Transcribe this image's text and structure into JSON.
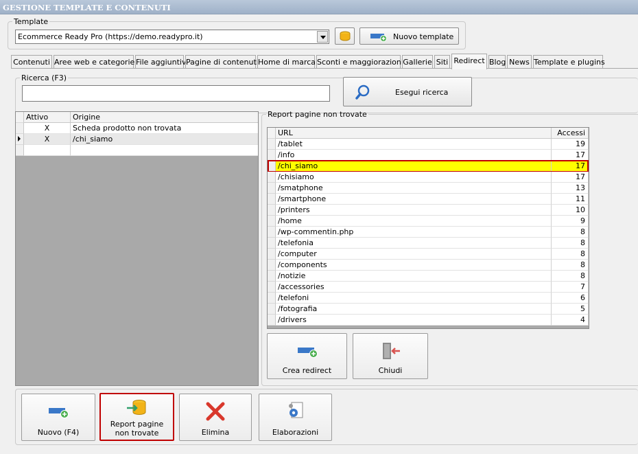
{
  "window": {
    "title": "GESTIONE TEMPLATE E CONTENUTI"
  },
  "template": {
    "legend": "Template",
    "selected": "Ecommerce Ready Pro (https://demo.readypro.it)",
    "new_button": "Nuovo template"
  },
  "tabs": [
    "Contenuti",
    "Aree web e categorie",
    "File aggiuntivi",
    "Pagine di contenuti",
    "Home di marca",
    "Sconti e maggiorazioni",
    "Gallerie",
    "Siti",
    "Redirect",
    "Blog",
    "News",
    "Template e plugins"
  ],
  "active_tab": "Redirect",
  "search": {
    "legend": "Ricerca (F3)",
    "value": "",
    "button": "Esegui ricerca"
  },
  "redirect_grid": {
    "columns": [
      "Attivo",
      "Origine"
    ],
    "rows": [
      {
        "attivo": "X",
        "origine": "Scheda prodotto non trovata"
      },
      {
        "attivo": "X",
        "origine": "/chi_siamo"
      }
    ]
  },
  "report": {
    "legend": "Report pagine non trovate",
    "columns": [
      "URL",
      "Accessi"
    ],
    "rows": [
      {
        "url": "/tablet",
        "accessi": "19"
      },
      {
        "url": "/info",
        "accessi": "17"
      },
      {
        "url": "/chi_siamo",
        "accessi": "17"
      },
      {
        "url": "/chisiamo",
        "accessi": "17"
      },
      {
        "url": "/smatphone",
        "accessi": "13"
      },
      {
        "url": "/smartphone",
        "accessi": "11"
      },
      {
        "url": "/printers",
        "accessi": "10"
      },
      {
        "url": "/home",
        "accessi": "9"
      },
      {
        "url": "/wp-commentin.php",
        "accessi": "8"
      },
      {
        "url": "/telefonia",
        "accessi": "8"
      },
      {
        "url": "/computer",
        "accessi": "8"
      },
      {
        "url": "/components",
        "accessi": "8"
      },
      {
        "url": "/notizie",
        "accessi": "8"
      },
      {
        "url": "/accessories",
        "accessi": "7"
      },
      {
        "url": "/telefoni",
        "accessi": "6"
      },
      {
        "url": "/fotografia",
        "accessi": "5"
      },
      {
        "url": "/drivers",
        "accessi": "4"
      }
    ],
    "highlight_color": "#ffff00",
    "highlight_border": "#c00000",
    "buttons": {
      "create": "Crea redirect",
      "close": "Chiudi"
    }
  },
  "bottom_buttons": {
    "new": "Nuovo (F4)",
    "report": "Report pagine non trovate",
    "delete": "Elimina",
    "processing": "Elaborazioni"
  }
}
